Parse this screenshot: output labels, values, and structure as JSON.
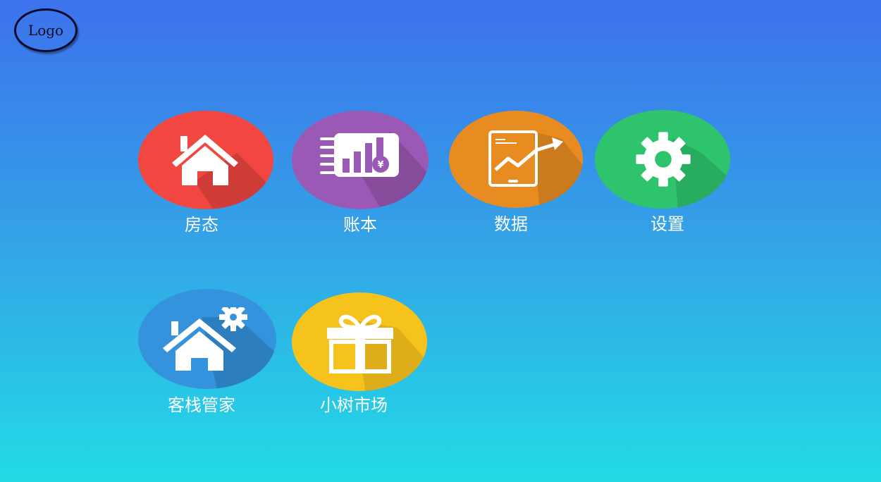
{
  "logo": {
    "text": "Logo"
  },
  "tiles": [
    {
      "label": "房态",
      "icon": "house-icon",
      "color": "#f24640"
    },
    {
      "label": "账本",
      "icon": "ledger-chart-icon",
      "color": "#9b59b6"
    },
    {
      "label": "数据",
      "icon": "tablet-trend-icon",
      "color": "#e88c22"
    },
    {
      "label": "设置",
      "icon": "gear-icon",
      "color": "#2ec46e"
    },
    {
      "label": "客栈管家",
      "icon": "house-gear-icon",
      "color": "#3593de"
    },
    {
      "label": "小树市场",
      "icon": "gift-icon",
      "color": "#f6c21c"
    }
  ]
}
